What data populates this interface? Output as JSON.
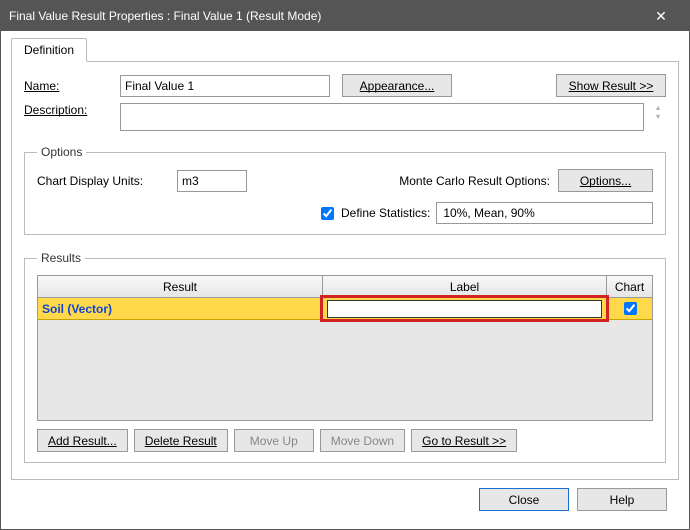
{
  "titlebar": {
    "text": "Final Value Result Properties : Final Value 1 (Result Mode)"
  },
  "tabs": {
    "definition": "Definition"
  },
  "fields": {
    "name_label": "Name:",
    "name_value": "Final Value 1",
    "appearance_btn": "Appearance...",
    "show_result_btn": "Show Result >>",
    "description_label": "Description:",
    "description_value": ""
  },
  "options": {
    "legend": "Options",
    "chart_units_label": "Chart Display Units:",
    "chart_units_value": "m3",
    "mc_label": "Monte Carlo Result Options:",
    "mc_btn": "Options...",
    "define_stats_label": "Define Statistics:",
    "stats_value": "10%, Mean, 90%"
  },
  "results": {
    "legend": "Results",
    "headers": {
      "result": "Result",
      "label": "Label",
      "chart": "Chart"
    },
    "row": {
      "result": "Soil (Vector)",
      "label": "",
      "chart_checked": true
    },
    "buttons": {
      "add": "Add Result...",
      "delete": "Delete Result",
      "moveup": "Move Up",
      "movedown": "Move Down",
      "goto": "Go to Result >>"
    }
  },
  "footer": {
    "close": "Close",
    "help": "Help"
  }
}
